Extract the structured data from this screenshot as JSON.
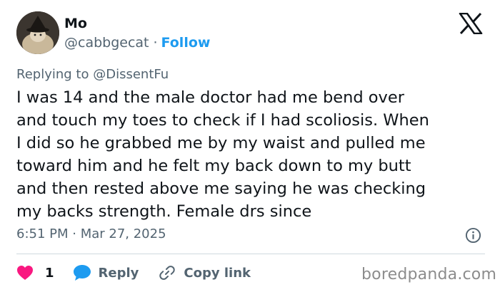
{
  "user": {
    "display_name": "Mo",
    "handle": "@cabbgecat",
    "separator": "·",
    "follow_label": "Follow"
  },
  "reply_context": {
    "prefix": "Replying to",
    "mention": "@DissentFu"
  },
  "tweet": {
    "lines": [
      "I was 14 and the male doctor had me bend over",
      "and touch my toes to check if I had scoliosis. When",
      "I did so he grabbed me by my waist and pulled me",
      "toward him and he felt my back down to my butt",
      "and then rested above me saying he was checking",
      "my backs strength. Female drs since"
    ],
    "timestamp": "6:51 PM · Mar 27, 2025"
  },
  "actions": {
    "like_count": "1",
    "reply_label": "Reply",
    "copy_label": "Copy link"
  },
  "watermark": "boredpanda.com",
  "icons": {
    "brand": "x-logo-icon",
    "info": "info-icon",
    "like": "heart-icon",
    "reply": "speech-bubble-icon",
    "copy": "link-icon"
  },
  "colors": {
    "accent": "#1d9bf0",
    "like": "#f91880",
    "muted": "#536471",
    "text": "#0f1419"
  }
}
